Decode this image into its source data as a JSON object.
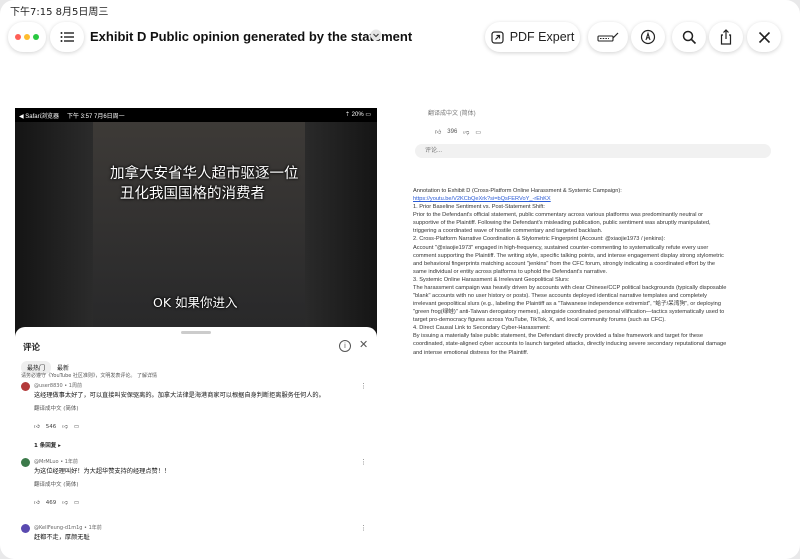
{
  "status": {
    "time_date": "下午7:15  8月5日周三"
  },
  "toolbar": {
    "title": "Exhibit D Public opinion generated by the statement",
    "pdf_expert_label": "PDF Expert",
    "colors": {
      "red": "#ff5f57",
      "yellow": "#febc2e",
      "green": "#28c840"
    }
  },
  "left_page": {
    "phone_status": {
      "left": "◀ Safari浏览器",
      "time": "下午 3:57  7月6日周一",
      "right": "⇡ 20% ▭"
    },
    "subtitles": {
      "line1": "加拿大安省华人超市驱逐一位",
      "line2": "丑化我国国格的消费者",
      "line3": "OK 如果你进入"
    },
    "comments_panel": {
      "heading": "评论",
      "tab_top": "最热门",
      "tab_new": "最新",
      "note": "请务必遵守《YouTube 社区准则》，文明发表评论。  了解详情",
      "comments": [
        {
          "user": "@user8830 • 1周前",
          "text": "这经理做事太好了，可以直接叫安保驱离的。加拿大法律是海港商家可以根据自身判断拒离服务任何人的。",
          "translate": "翻译成中文 (简体)",
          "likes": "546",
          "avatar_color": "#b33a3a"
        },
        {
          "user": "@MrMLuo • 1年前",
          "text": "为这位经理叫好！为大超华赞支持的经理点赞！！",
          "translate": "翻译成中文 (简体)",
          "likes": "469",
          "avatar_color": "#3c7a4a"
        },
        {
          "user": "@KellFeung-d1m1g • 1年前",
          "text": "赶都不走，厚颜无耻",
          "translate": "",
          "likes": "",
          "avatar_color": "#5a4ab0"
        }
      ],
      "replies_label": "1 条回复 ▸"
    }
  },
  "right_page": {
    "top_text": "翻译成中文 (简体)",
    "likes": "396",
    "comment_placeholder": "评论...",
    "annotation_lines": [
      "Annotation to Exhibit D (Cross-Platform Online Harassment & Systemic Campaign):",
      "https://youtu.be/V2KCbQeXrk?si=bQsFERVoY_-rEhKX",
      "1. Prior Baseline Sentiment vs. Post-Statement Shift:",
      "Prior to the Defendant's official statement, public commentary across various platforms was predominantly neutral or",
      "supportive of the Plaintiff. Following the Defendant's misleading publication, public sentiment was abruptly manipulated,",
      "triggering a coordinated wave of hostile commentary and targeted backlash.",
      "2. Cross-Platform Narrative Coordination & Stylometric Fingerprint (Account: @xiaojie1973 / jenkins):",
      "Account \"@xiaojie1973\" engaged in high-frequency, sustained counter-commenting to systematically refute every user",
      "comment supporting the Plaintiff. The writing style, specific talking points, and intense engagement display strong stylometric",
      "and behavioral fingerprints matching account \"jenkins\" from the CFC forum, strongly indicating a coordinated effort by the",
      "same individual or entity across platforms to uphold the Defendant's narrative.",
      "3. Systemic Online Harassment & Irrelevant Geopolitical Slurs:",
      "The harassment campaign was heavily driven by accounts with clear Chinese/CCP political backgrounds (typically disposable",
      "\"blank\" accounts with no user history or posts). These accounts deployed identical narrative templates and completely",
      "irrelevant geopolitical slurs (e.g., labeling the Plaintiff as a \"Taiwanese independence extremist\", \"蛤子/呆湾狗\", or deploying",
      "\"green frog(绿蛙)\" anti-Taiwan derogatory memes), alongside coordinated personal vilification—tactics systematically used to",
      "target pro-democracy figures across YouTube, TikTok, X, and local community forums (such as CFC).",
      "4. Direct Causal Link to Secondary Cyber-Harassment:",
      "By issuing a materially false public statement, the Defendant directly provided a false framework and target for these",
      "coordinated, state-aligned cyber accounts to launch targeted attacks, directly inducing severe secondary reputational damage",
      "and intense emotional distress for the Plaintiff."
    ]
  }
}
